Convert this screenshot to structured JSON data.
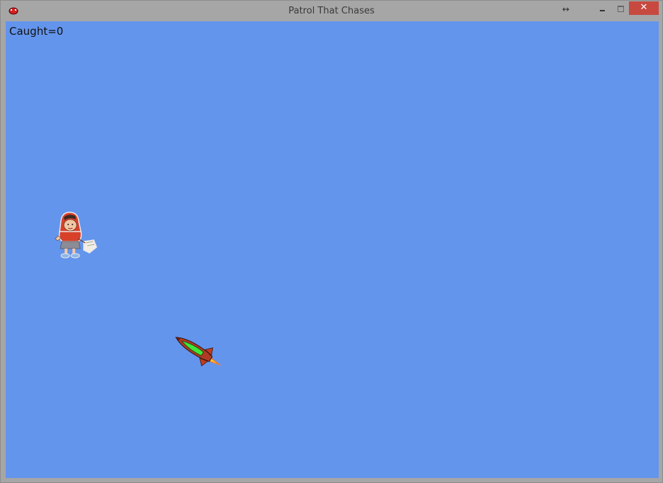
{
  "window": {
    "title": "Patrol That Chases",
    "app_icon": "pygame-snake-icon",
    "controls": {
      "resize_icon": "↔",
      "close_label": "✕"
    }
  },
  "game": {
    "score_text": "Caught=0",
    "background_color": "#6495ed",
    "sprites": [
      "girl-with-basket",
      "rocket"
    ]
  }
}
